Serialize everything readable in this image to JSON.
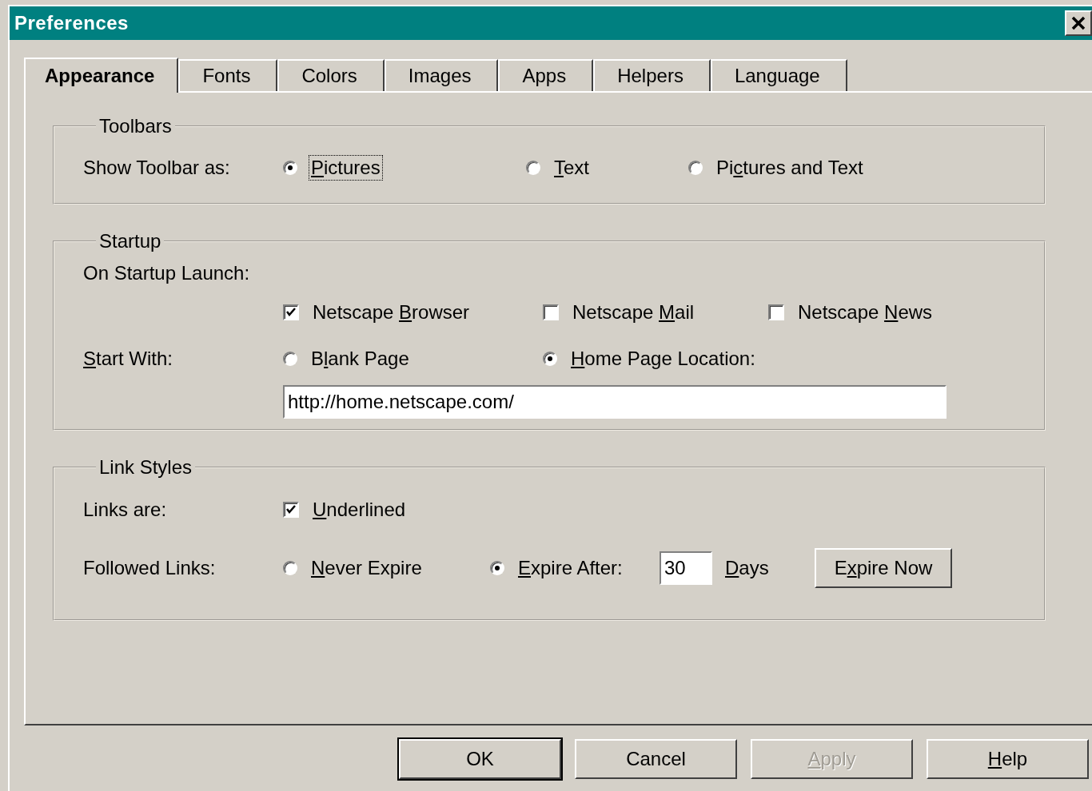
{
  "window": {
    "title": "Preferences"
  },
  "tabs": [
    {
      "label": "Appearance",
      "selected": true
    },
    {
      "label": "Fonts",
      "selected": false
    },
    {
      "label": "Colors",
      "selected": false
    },
    {
      "label": "Images",
      "selected": false
    },
    {
      "label": "Apps",
      "selected": false
    },
    {
      "label": "Helpers",
      "selected": false
    },
    {
      "label": "Language",
      "selected": false
    }
  ],
  "toolbars": {
    "title": "Toolbars",
    "label": "Show Toolbar as:",
    "options": [
      {
        "label": {
          "key": "P",
          "post": "ictures"
        },
        "selected": true,
        "focused": true
      },
      {
        "label": {
          "key": "T",
          "post": "ext"
        },
        "selected": false,
        "focused": false
      },
      {
        "label": {
          "pre": "Pi",
          "key": "c",
          "post": "tures and Text"
        },
        "selected": false,
        "focused": false
      }
    ]
  },
  "startup": {
    "title": "Startup",
    "launch_label": "On Startup Launch:",
    "launch": [
      {
        "label": {
          "pre": "Netscape ",
          "key": "B",
          "post": "rowser"
        },
        "checked": true
      },
      {
        "label": {
          "pre": "Netscape ",
          "key": "M",
          "post": "ail"
        },
        "checked": false
      },
      {
        "label": {
          "pre": "Netscape ",
          "key": "N",
          "post": "ews"
        },
        "checked": false
      }
    ],
    "start_with_label": {
      "key": "S",
      "post": "tart With:"
    },
    "start_with": [
      {
        "label": {
          "pre": "B",
          "key": "l",
          "post": "ank Page"
        },
        "selected": false
      },
      {
        "label": {
          "key": "H",
          "post": "ome Page Location:"
        },
        "selected": true
      }
    ],
    "home_url": "http://home.netscape.com/"
  },
  "link_styles": {
    "title": "Link Styles",
    "links_label": "Links are:",
    "underlined": {
      "label": {
        "key": "U",
        "post": "nderlined"
      },
      "checked": true
    },
    "followed_label": "Followed Links:",
    "followed": [
      {
        "label": {
          "key": "N",
          "post": "ever Expire"
        },
        "selected": false
      },
      {
        "label": {
          "key": "E",
          "post": "xpire After:"
        },
        "selected": true
      }
    ],
    "days": "30",
    "days_label": {
      "key": "D",
      "post": "ays"
    },
    "expire_now": {
      "pre": "E",
      "key": "x",
      "post": "pire Now"
    }
  },
  "buttons": [
    {
      "label": {
        "post": "OK"
      },
      "default": true,
      "disabled": false
    },
    {
      "label": {
        "post": "Cancel"
      },
      "default": false,
      "disabled": false
    },
    {
      "label": {
        "key": "A",
        "post": "pply"
      },
      "default": false,
      "disabled": true
    },
    {
      "label": {
        "key": "H",
        "post": "elp"
      },
      "default": false,
      "disabled": false
    }
  ]
}
